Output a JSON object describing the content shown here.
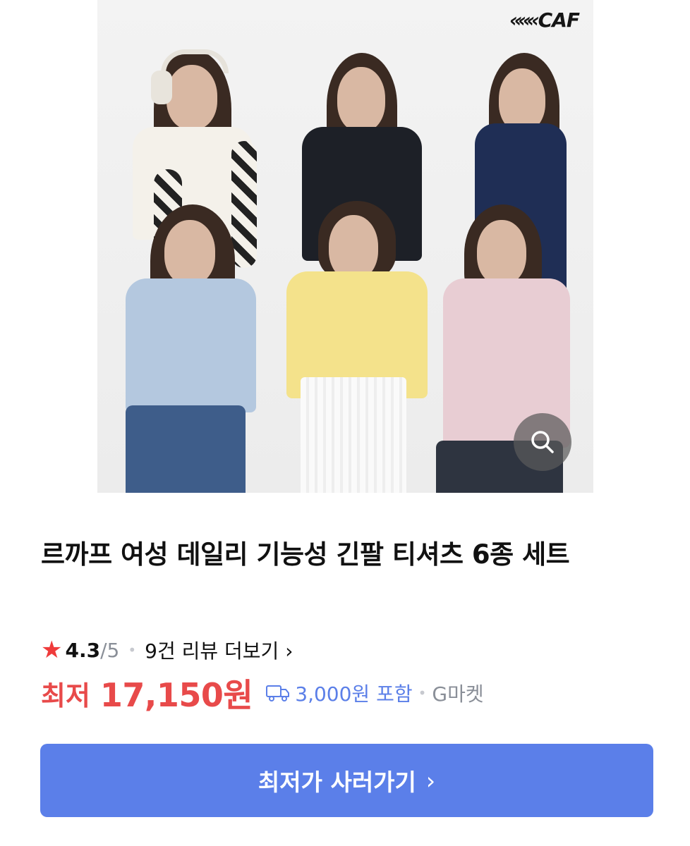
{
  "product": {
    "brand_logo": "CAF",
    "title": "르까프 여성 데일리 기능성 긴팔 티셔츠 6종 세트",
    "rating": "4.3",
    "rating_max": "/5",
    "review_link": "9건 리뷰 더보기",
    "price_prefix": "최저",
    "price": "17,150원",
    "shipping": "3,000원 포함",
    "seller": "G마켓",
    "cta_label": "최저가 사러가기"
  },
  "icons": {
    "star": "star-icon",
    "chevron": "chevron-right-icon",
    "truck": "truck-icon",
    "zoom": "search-icon"
  },
  "colors": {
    "accent": "#5b7fe9",
    "price": "#e84a4a",
    "star": "#ef3b3b",
    "muted": "#8a8f98"
  }
}
